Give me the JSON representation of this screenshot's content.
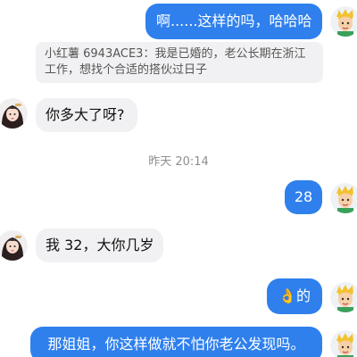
{
  "conversation": {
    "messages": [
      {
        "id": "m1",
        "side": "outgoing",
        "text": "啊......这样的吗，哈哈哈"
      },
      {
        "id": "m2",
        "side": "outgoing-quote",
        "text": "小红薯 6943ACE3：我是已婚的，老公长期在浙江工作，想找个合适的搭伙过日子"
      },
      {
        "id": "m3",
        "side": "incoming",
        "text": "你多大了呀?"
      },
      {
        "id": "m4",
        "side": "outgoing",
        "text": "28"
      },
      {
        "id": "m5",
        "side": "incoming",
        "text": "我 32，大你几岁"
      },
      {
        "id": "m6",
        "side": "outgoing",
        "text": "👌的"
      },
      {
        "id": "m7",
        "side": "outgoing",
        "text": "那姐姐，你这样做就不怕你老公发现吗。"
      }
    ],
    "timestamp": "昨天 20:14"
  },
  "participants": {
    "self": {
      "avatar_icon": "cartoon-boy-avatar-icon"
    },
    "other": {
      "avatar_icon": "woman-portrait-avatar-icon"
    }
  },
  "colors": {
    "outgoing_bubble": "#2f80ed",
    "incoming_bubble": "#f1f1f3",
    "timestamp_text": "#8e8e93"
  }
}
